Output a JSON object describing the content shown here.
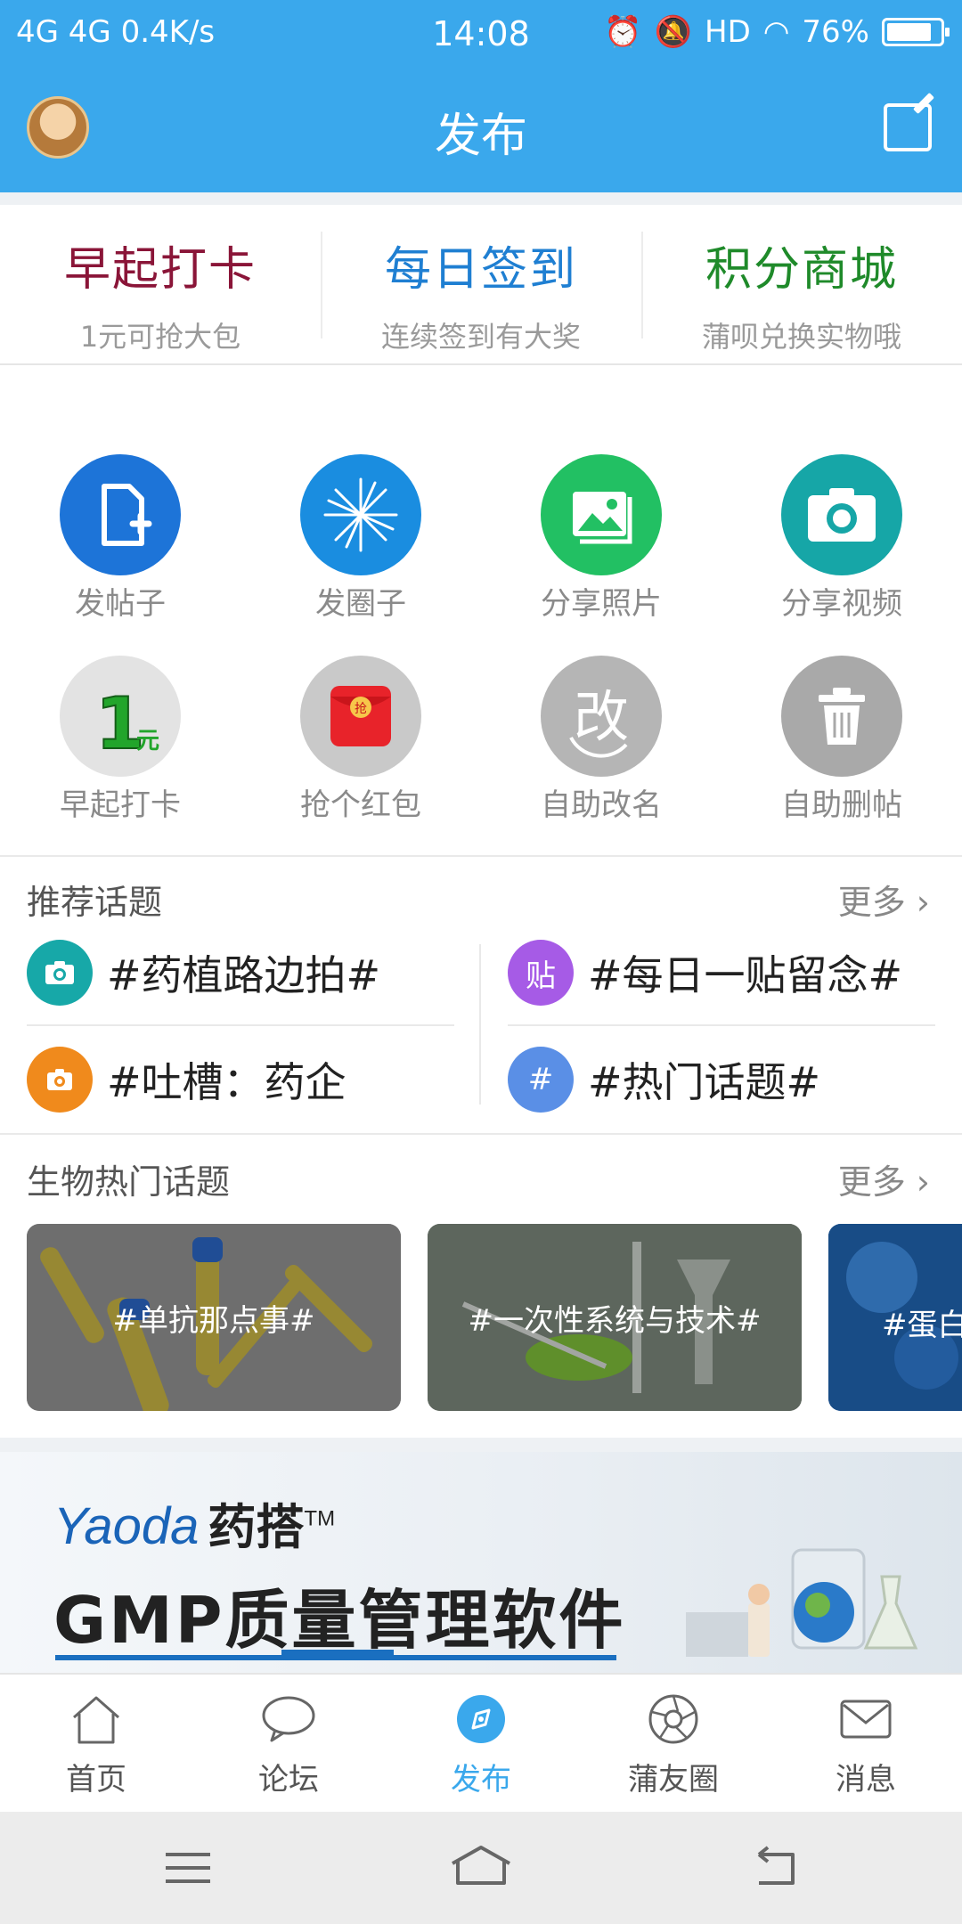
{
  "status_bar": {
    "network": "4G 4G 0.4K/s",
    "time": "14:08",
    "hd": "HD",
    "battery": "76%",
    "battery_level": 0.76
  },
  "header": {
    "title": "发布"
  },
  "quick_links": [
    {
      "title": "早起打卡",
      "subtitle": "1元可抢大包",
      "color": "#8a1538"
    },
    {
      "title": "每日签到",
      "subtitle": "连续签到有大奖",
      "color": "#1f7fd2"
    },
    {
      "title": "积分商城",
      "subtitle": "蒲呗兑换实物哦",
      "color": "#1f8a2a"
    }
  ],
  "actions": [
    {
      "label": "发帖子",
      "color": "#1d74d8",
      "icon": "post-icon"
    },
    {
      "label": "发圈子",
      "color": "#1a8de0",
      "icon": "circle-burst-icon"
    },
    {
      "label": "分享照片",
      "color": "#22c063",
      "icon": "photo-icon"
    },
    {
      "label": "分享视频",
      "color": "#16a6a7",
      "icon": "camera-icon"
    },
    {
      "label": "早起打卡",
      "color": "#e3e3e3",
      "icon": "one-yuan-icon",
      "badge": "1元"
    },
    {
      "label": "抢个红包",
      "color": "#c9c9c9",
      "icon": "red-envelope-icon",
      "badge": "抢"
    },
    {
      "label": "自助改名",
      "color": "#b5b5b5",
      "icon": "rename-icon",
      "badge": "改"
    },
    {
      "label": "自助删帖",
      "color": "#a9a9a9",
      "icon": "trash-icon"
    }
  ],
  "recommended": {
    "title": "推荐话题",
    "more": "更多",
    "topics": [
      {
        "label": "#药植路边拍#",
        "color": "#17a8a8",
        "icon": "camera-icon",
        "glyph": ""
      },
      {
        "label": "#每日一贴留念#",
        "color": "#a65be6",
        "icon": "sticker-icon",
        "glyph": "贴"
      },
      {
        "label": "#吐槽：药企",
        "color": "#f08a1c",
        "icon": "camera-icon",
        "glyph": ""
      },
      {
        "label": "#热门话题#",
        "color": "#5a8fe6",
        "icon": "hashtag-icon",
        "glyph": "#"
      }
    ]
  },
  "bio": {
    "title": "生物热门话题",
    "more": "更多",
    "cards": [
      "#单抗那点事#",
      "#一次性系统与技术#",
      "#蛋白"
    ]
  },
  "banner": {
    "brand": "Yaoda",
    "brand_cn": "药搭",
    "tm": "TM",
    "headline": "GMP质量管理软件"
  },
  "bottom_nav": [
    {
      "label": "首页",
      "icon": "home-icon"
    },
    {
      "label": "论坛",
      "icon": "chat-icon"
    },
    {
      "label": "发布",
      "icon": "publish-icon",
      "active": true
    },
    {
      "label": "蒲友圈",
      "icon": "aperture-icon"
    },
    {
      "label": "消息",
      "icon": "mail-icon"
    }
  ]
}
